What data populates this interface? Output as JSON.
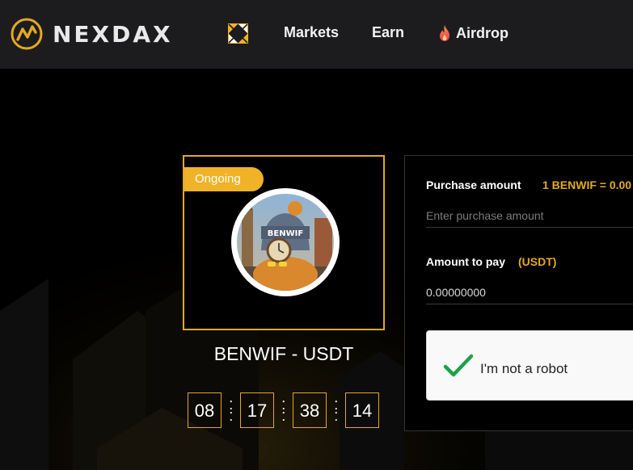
{
  "header": {
    "brand": "NEXDAX",
    "nav": {
      "markets": "Markets",
      "earn": "Earn",
      "airdrop": "Airdrop"
    }
  },
  "token": {
    "status_badge": "Ongoing",
    "pair": "BENWIF - USDT",
    "avatar_text": "BENWIF",
    "countdown": [
      "08",
      "17",
      "38",
      "14"
    ],
    "separator": ":"
  },
  "purchase": {
    "amount_label": "Purchase amount",
    "rate_text": "1 BENWIF = 0.00",
    "amount_placeholder": "Enter purchase amount",
    "pay_label": "Amount to pay",
    "pay_currency": "(USDT)",
    "pay_value": "0.00000000",
    "captcha_label": "I'm not a robot"
  },
  "colors": {
    "accent": "#e3a921",
    "topbar": "#1c1c1e",
    "background": "#000000",
    "captcha_check": "#1fa149"
  }
}
